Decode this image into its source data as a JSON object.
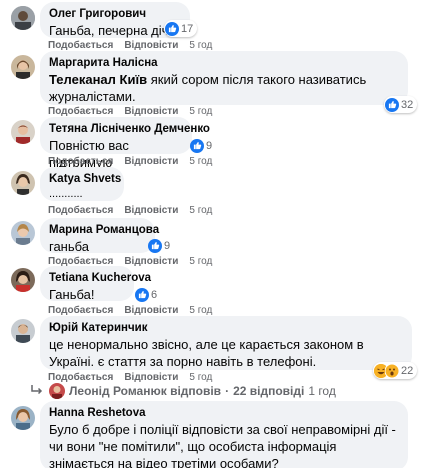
{
  "actions": {
    "like": "Подобається",
    "reply": "Відповісти"
  },
  "comments": [
    {
      "author": "Олег Григорович",
      "text": "Ганьба, печерна дічь",
      "time": "5 год",
      "reactions": "17"
    },
    {
      "author": "Маргарита Налісна",
      "text_bold": "Телеканал Київ",
      "text": " який сором після такого називатись журналістами.",
      "time": "5 год",
      "reactions": "32"
    },
    {
      "author": "Тетяна Лісніченко Демченко",
      "text": "Повністю вас підтримую",
      "time": "5 год",
      "reactions": "9"
    },
    {
      "author": "Katya Shvets",
      "text": "...........",
      "time": "5 год",
      "reactions": ""
    },
    {
      "author": "Марина Романцова",
      "text": "ганьба",
      "time": "5 год",
      "reactions": "9"
    },
    {
      "author": "Tetiana Kucherova",
      "text": "Ганьба!",
      "time": "5 год",
      "reactions": "6"
    },
    {
      "author": "Юрій Катеринчик",
      "text": "це ненормально звісно, але це карається законом в Україні. є стаття за порно навіть в телефоні.",
      "time": "5 год",
      "reactions": "22"
    },
    {
      "author": "Hanna Reshetova",
      "text": "Було б добре і поліції відповісти за свої неправомірні дії - чи вони \"не помітили\", що особиста інформація знімається на відео третіми особами?",
      "time": "",
      "reactions": ""
    }
  ],
  "replies": {
    "who": "Леонід Романюк відповів",
    "sep": "·",
    "count": "22 відповіді",
    "time": "1 год"
  },
  "colors": {
    "bubble": "#f0f2f5",
    "like": "#1877f2",
    "haha": "#f7b125",
    "meta": "#65676b"
  }
}
